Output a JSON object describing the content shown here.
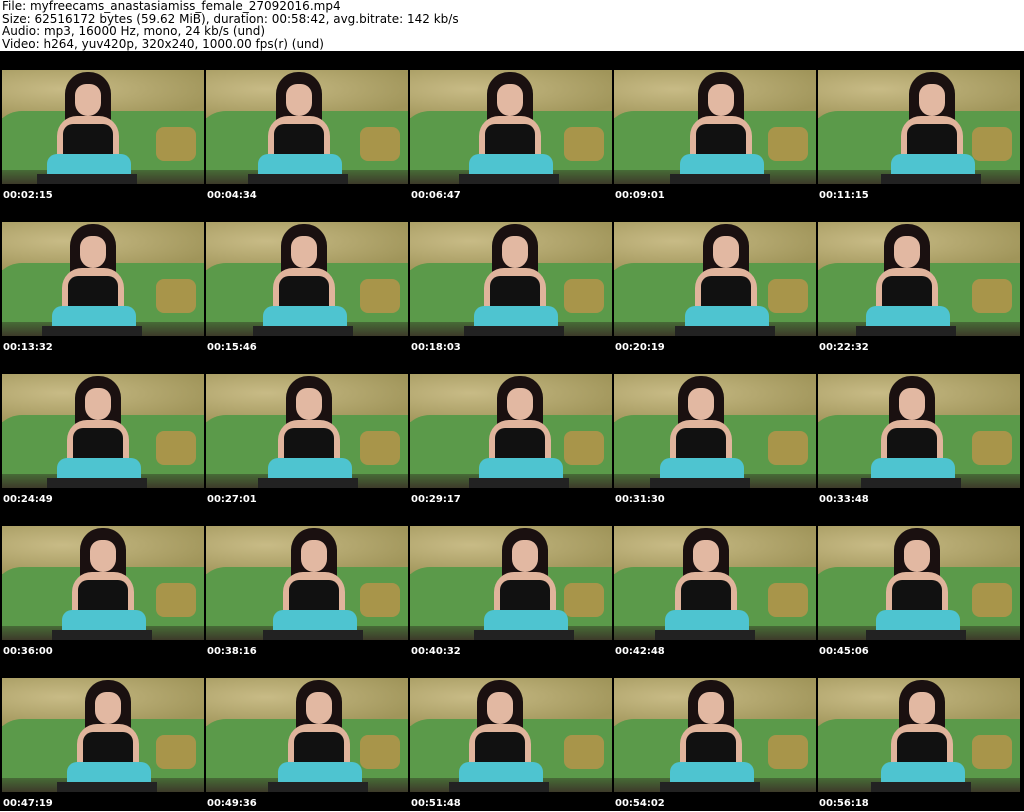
{
  "header": {
    "file": "File: myfreecams_anastasiamiss_female_27092016.mp4",
    "size": "Size: 62516172 bytes (59.62 MiB), duration: 00:58:42, avg.bitrate: 142 kb/s",
    "audio": "Audio: mp3, 16000 Hz, mono, 24 kb/s (und)",
    "video": "Video: h264, yuv420p, 320x240, 1000.00 fps(r) (und)"
  },
  "timestamps": [
    "00:02:15",
    "00:04:34",
    "00:06:47",
    "00:09:01",
    "00:11:15",
    "00:13:32",
    "00:15:46",
    "00:18:03",
    "00:20:19",
    "00:22:32",
    "00:24:49",
    "00:27:01",
    "00:29:17",
    "00:31:30",
    "00:33:48",
    "00:36:00",
    "00:38:16",
    "00:40:32",
    "00:42:48",
    "00:45:06",
    "00:47:19",
    "00:49:36",
    "00:51:48",
    "00:54:02",
    "00:56:18"
  ]
}
